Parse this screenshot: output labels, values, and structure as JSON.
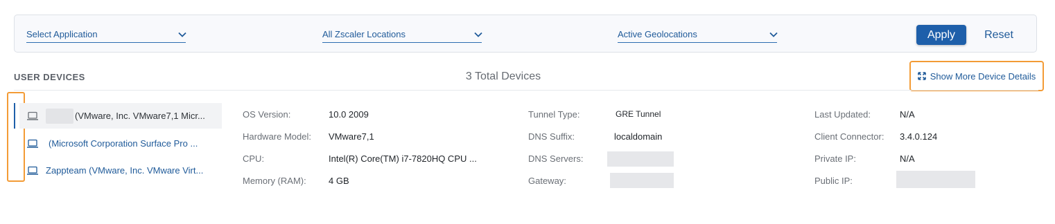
{
  "filters": {
    "application": "Select Application",
    "locations": "All Zscaler Locations",
    "geolocations": "Active Geolocations",
    "apply_label": "Apply",
    "reset_label": "Reset"
  },
  "devices_section": {
    "title": "USER DEVICES",
    "total": "3 Total Devices",
    "show_more_label": "Show More Device Details"
  },
  "devices": [
    {
      "name": "(VMware, Inc. VMware7,1 Micr...",
      "icon": "laptop-icon",
      "selected": true
    },
    {
      "name": "(Microsoft Corporation Surface Pro ...",
      "icon": "laptop-icon",
      "selected": false
    },
    {
      "name": "Zappteam (VMware, Inc. VMware Virt...",
      "icon": "laptop-icon",
      "selected": false
    }
  ],
  "details": {
    "os_version": {
      "label": "OS Version:",
      "value": "10.0 2009"
    },
    "hardware_model": {
      "label": "Hardware Model:",
      "value": "VMware7,1"
    },
    "cpu": {
      "label": "CPU:",
      "value": "Intel(R) Core(TM) i7-7820HQ CPU ..."
    },
    "memory": {
      "label": "Memory (RAM):",
      "value": "4 GB"
    },
    "tunnel_type": {
      "label": "Tunnel Type:",
      "value": "GRE Tunnel"
    },
    "dns_suffix": {
      "label": "DNS Suffix:",
      "value": "localdomain"
    },
    "dns_servers": {
      "label": "DNS Servers:",
      "value": ""
    },
    "gateway": {
      "label": "Gateway:",
      "value": ""
    },
    "last_updated": {
      "label": "Last Updated:",
      "value": "N/A"
    },
    "client_connector": {
      "label": "Client Connector:",
      "value": "3.4.0.124"
    },
    "private_ip": {
      "label": "Private IP:",
      "value": "N/A"
    },
    "public_ip": {
      "label": "Public IP:",
      "value": ""
    }
  },
  "colors": {
    "accent": "#1e5faa",
    "link": "#1f5a99",
    "highlight": "#f39b35"
  }
}
